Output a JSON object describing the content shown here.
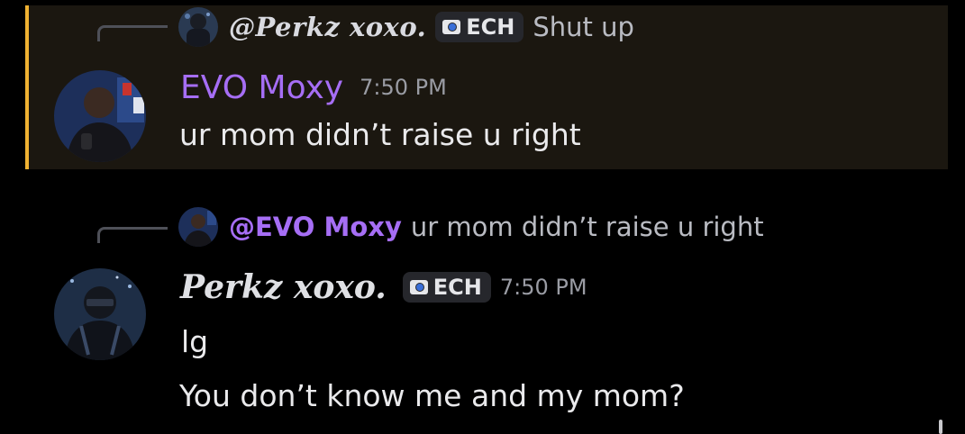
{
  "message_1": {
    "reply": {
      "author": "@Perkz xoxo.",
      "tag": "ECH",
      "text": "Shut up"
    },
    "author": "EVO Moxy",
    "time": "7:50 PM",
    "lines": [
      "ur mom didn’t raise u right"
    ]
  },
  "message_2": {
    "reply": {
      "author": "@EVO Moxy",
      "text": "ur mom didn’t raise u right"
    },
    "author": "Perkz xoxo.",
    "tag": "ECH",
    "time": "7:50 PM",
    "lines": [
      "lg",
      "You don’t know me and my mom?"
    ]
  },
  "colors": {
    "mention_highlight": "#1b1710",
    "mention_bar": "#f0b232",
    "evo_name": "#a66ef5",
    "background": "#000000"
  },
  "icons": {
    "tag_icon": "guild-tag-icon"
  }
}
